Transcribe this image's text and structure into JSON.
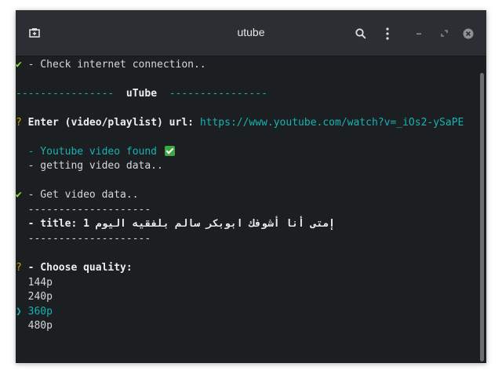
{
  "window": {
    "title": "utube"
  },
  "icons": {
    "new_tab": "new-tab-icon",
    "search": "search-icon",
    "menu": "kebab-menu-icon",
    "minimize": "minimize-icon",
    "maximize": "maximize-icon",
    "close": "close-icon"
  },
  "terminal": {
    "check_mark": "✔",
    "question_mark": "?",
    "pointer": "❯",
    "line_check_internet": " - Check internet connection..",
    "banner_left": "----------------",
    "banner_title": "uTube",
    "banner_right": "----------------",
    "prompt_label": " Enter (video/playlist) url: ",
    "prompt_url": "https://www.youtube.com/watch?v=_iOs2-ySaPE",
    "video_found": "  - Youtube video found ",
    "getting_data": "  - getting video data..",
    "get_video_data": " - Get video data..",
    "separator": "  --------------------",
    "title_line": "  - title: إمتى أنا أشوفك ابوبكر سالم بلفقيه اليوم 1",
    "choose_quality": " - Choose quality:",
    "qualities": [
      "144p",
      "240p",
      "360p",
      "480p"
    ],
    "selected_quality": "360p"
  },
  "colors": {
    "terminal_bg": "#1c1f22",
    "titlebar_bg": "#2b2e32",
    "green": "#8ae234",
    "cyan": "#18b2b2",
    "yellow": "#c4a000"
  }
}
